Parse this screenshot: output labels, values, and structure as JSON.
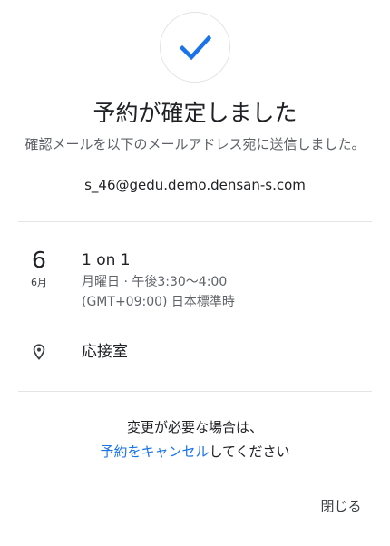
{
  "header": {
    "icon": "check-icon",
    "accent_color": "#1a73e8",
    "title": "予約が確定しました",
    "subtitle": "確認メールを以下のメールアドレス宛に送信しました。",
    "email": "s_46@gedu.demo.densan-s.com"
  },
  "event": {
    "day": "6",
    "month": "6月",
    "title": "1 on 1",
    "time": "月曜日 · 午後3:30～4:00",
    "timezone": "(GMT+09:00) 日本標準時"
  },
  "location": {
    "icon": "location-pin-icon",
    "name": "応接室"
  },
  "footer": {
    "change_note": "変更が必要な場合は、",
    "cancel_link": "予約をキャンセル",
    "cancel_suffix": "してください",
    "close_label": "閉じる"
  }
}
